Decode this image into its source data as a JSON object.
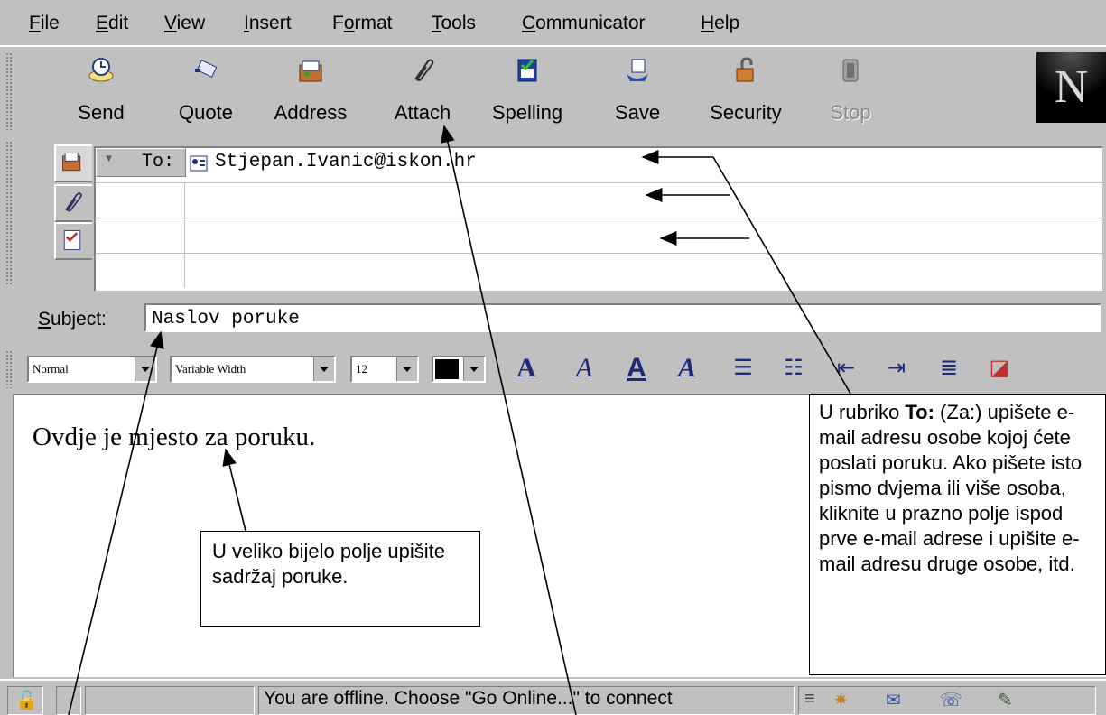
{
  "menu": [
    {
      "label": "File",
      "ul": "F"
    },
    {
      "label": "Edit",
      "ul": "E"
    },
    {
      "label": "View",
      "ul": "V"
    },
    {
      "label": "Insert",
      "ul": "I"
    },
    {
      "label": "Format",
      "ul": "o"
    },
    {
      "label": "Tools",
      "ul": "T"
    },
    {
      "label": "Communicator",
      "ul": "C"
    },
    {
      "label": "Help",
      "ul": "H"
    }
  ],
  "toolbar": {
    "send": "Send",
    "quote": "Quote",
    "address": "Address",
    "attach": "Attach",
    "spelling": "Spelling",
    "save": "Save",
    "security": "Security",
    "stop": "Stop",
    "logo": "N"
  },
  "addressing": {
    "to_label": "To:",
    "to_value": "Stjepan.Ivanic@iskon.hr"
  },
  "subject": {
    "label": "Subject:",
    "value": "Naslov poruke"
  },
  "format": {
    "paragraph_style": "Normal",
    "font": "Variable Width",
    "size": "12",
    "color": "#000000"
  },
  "body": {
    "text": "Ovdje je mjesto za poruku."
  },
  "status": {
    "text": "You are offline. Choose \"Go Online...\" to connect"
  },
  "callouts": {
    "body_hint": "U veliko bijelo polje upišite sadržaj poruke.",
    "to_hint_bold": "To:",
    "to_hint_pre": "U rubriko ",
    "to_hint_post": " (Za:) upišete e-mail adresu osobe kojoj ćete poslati poruku. Ako pišete isto pismo dvjema ili više osoba, kliknite u prazno polje ispod prve e-mail adrese i upišite e-mail adresu druge osobe, itd."
  }
}
